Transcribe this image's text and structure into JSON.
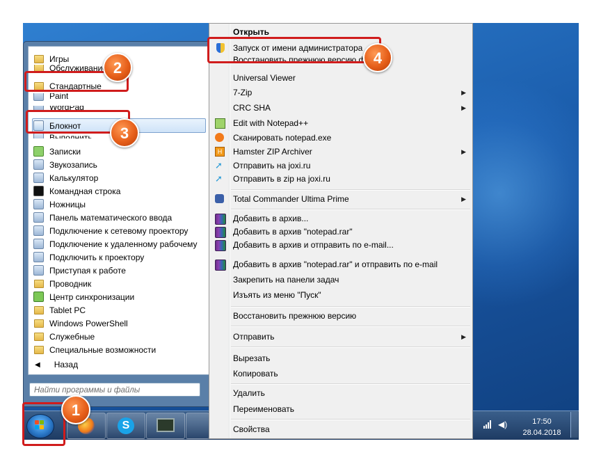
{
  "start_menu": {
    "programs": [
      {
        "label": "Игры",
        "icon": "folder-icon"
      },
      {
        "label": "Обслуживание",
        "icon": "folder-icon"
      },
      {
        "label": "Стандартные",
        "icon": "folder-icon"
      },
      {
        "label": "Paint",
        "icon": "paint-icon"
      },
      {
        "label": "WordPad",
        "icon": "wordpad-icon"
      },
      {
        "label": "Блокнот",
        "icon": "notepad-icon"
      },
      {
        "label": "Выполнить",
        "icon": "run-icon"
      },
      {
        "label": "Записки",
        "icon": "sticky-notes-icon"
      },
      {
        "label": "Звукозапись",
        "icon": "microphone-icon"
      },
      {
        "label": "Калькулятор",
        "icon": "calculator-icon"
      },
      {
        "label": "Командная строка",
        "icon": "cmd-icon"
      },
      {
        "label": "Ножницы",
        "icon": "scissors-icon"
      },
      {
        "label": "Панель математического ввода",
        "icon": "math-input-icon"
      },
      {
        "label": "Подключение к сетевому проектору",
        "icon": "network-projector-icon"
      },
      {
        "label": "Подключение к удаленному рабочему",
        "icon": "remote-desktop-icon"
      },
      {
        "label": "Подключить к проектору",
        "icon": "projector-icon"
      },
      {
        "label": "Приступая к работе",
        "icon": "getting-started-icon"
      },
      {
        "label": "Проводник",
        "icon": "explorer-icon"
      },
      {
        "label": "Центр синхронизации",
        "icon": "sync-center-icon"
      },
      {
        "label": "Tablet PC",
        "icon": "folder-icon"
      },
      {
        "label": "Windows PowerShell",
        "icon": "folder-icon"
      },
      {
        "label": "Служебные",
        "icon": "folder-icon"
      },
      {
        "label": "Специальные возможности",
        "icon": "folder-icon"
      }
    ],
    "back_label": "Назад",
    "search_placeholder": "Найти программы и файлы"
  },
  "context_menu": {
    "items": [
      {
        "label": "Открыть",
        "bold": true
      },
      {
        "label": "Запуск от имени администратора",
        "icon": "uac-shield-icon"
      },
      {
        "label": "Восстановить прежнюю версию файла"
      },
      {
        "label": "Universal Viewer"
      },
      {
        "label": "7-Zip",
        "submenu": true
      },
      {
        "label": "CRC SHA",
        "submenu": true
      },
      {
        "label": "Edit with Notepad++",
        "icon": "notepadpp-icon"
      },
      {
        "label": "Сканировать notepad.exe",
        "icon": "avast-icon"
      },
      {
        "label": "Hamster ZIP Archiver",
        "icon": "hamster-icon",
        "submenu": true
      },
      {
        "label": "Отправить на joxi.ru",
        "icon": "joxi-icon"
      },
      {
        "label": "Отправить в zip на joxi.ru",
        "icon": "joxi-icon"
      },
      {
        "label": "Total Commander Ultima Prime",
        "icon": "total-commander-icon",
        "submenu": true
      },
      {
        "label": "Добавить в архив...",
        "icon": "winrar-icon"
      },
      {
        "label": "Добавить в архив \"notepad.rar\"",
        "icon": "winrar-icon"
      },
      {
        "label": "Добавить в архив и отправить по e-mail...",
        "icon": "winrar-icon"
      },
      {
        "label": "Добавить в архив \"notepad.rar\" и отправить по e-mail",
        "icon": "winrar-icon"
      },
      {
        "label": "Закрепить на панели задач"
      },
      {
        "label": "Изъять из меню \"Пуск\""
      },
      {
        "label": "Восстановить прежнюю версию"
      },
      {
        "label": "Отправить",
        "submenu": true
      },
      {
        "label": "Вырезать"
      },
      {
        "label": "Копировать"
      },
      {
        "label": "Удалить"
      },
      {
        "label": "Переименовать"
      },
      {
        "label": "Свойства"
      }
    ],
    "submenu_arrow": "▶"
  },
  "taskbar": {
    "clock_time": "17:50",
    "clock_date": "28.04.2018"
  },
  "callouts": [
    "1",
    "2",
    "3",
    "4"
  ],
  "colors": {
    "callout": "#d01c1c",
    "badge": "#e65f1a",
    "taskbar": "#1e3b63"
  }
}
